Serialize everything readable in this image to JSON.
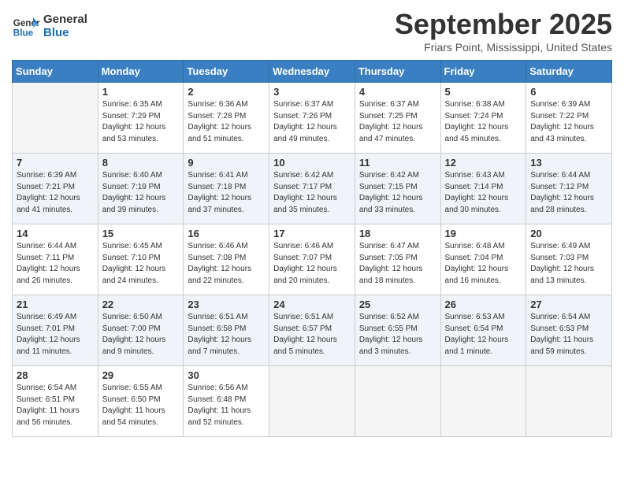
{
  "logo": {
    "line1": "General",
    "line2": "Blue"
  },
  "title": "September 2025",
  "location": "Friars Point, Mississippi, United States",
  "weekdays": [
    "Sunday",
    "Monday",
    "Tuesday",
    "Wednesday",
    "Thursday",
    "Friday",
    "Saturday"
  ],
  "weeks": [
    [
      {
        "day": null,
        "info": []
      },
      {
        "day": "1",
        "info": [
          "Sunrise: 6:35 AM",
          "Sunset: 7:29 PM",
          "Daylight: 12 hours",
          "and 53 minutes."
        ]
      },
      {
        "day": "2",
        "info": [
          "Sunrise: 6:36 AM",
          "Sunset: 7:28 PM",
          "Daylight: 12 hours",
          "and 51 minutes."
        ]
      },
      {
        "day": "3",
        "info": [
          "Sunrise: 6:37 AM",
          "Sunset: 7:26 PM",
          "Daylight: 12 hours",
          "and 49 minutes."
        ]
      },
      {
        "day": "4",
        "info": [
          "Sunrise: 6:37 AM",
          "Sunset: 7:25 PM",
          "Daylight: 12 hours",
          "and 47 minutes."
        ]
      },
      {
        "day": "5",
        "info": [
          "Sunrise: 6:38 AM",
          "Sunset: 7:24 PM",
          "Daylight: 12 hours",
          "and 45 minutes."
        ]
      },
      {
        "day": "6",
        "info": [
          "Sunrise: 6:39 AM",
          "Sunset: 7:22 PM",
          "Daylight: 12 hours",
          "and 43 minutes."
        ]
      }
    ],
    [
      {
        "day": "7",
        "info": [
          "Sunrise: 6:39 AM",
          "Sunset: 7:21 PM",
          "Daylight: 12 hours",
          "and 41 minutes."
        ]
      },
      {
        "day": "8",
        "info": [
          "Sunrise: 6:40 AM",
          "Sunset: 7:19 PM",
          "Daylight: 12 hours",
          "and 39 minutes."
        ]
      },
      {
        "day": "9",
        "info": [
          "Sunrise: 6:41 AM",
          "Sunset: 7:18 PM",
          "Daylight: 12 hours",
          "and 37 minutes."
        ]
      },
      {
        "day": "10",
        "info": [
          "Sunrise: 6:42 AM",
          "Sunset: 7:17 PM",
          "Daylight: 12 hours",
          "and 35 minutes."
        ]
      },
      {
        "day": "11",
        "info": [
          "Sunrise: 6:42 AM",
          "Sunset: 7:15 PM",
          "Daylight: 12 hours",
          "and 33 minutes."
        ]
      },
      {
        "day": "12",
        "info": [
          "Sunrise: 6:43 AM",
          "Sunset: 7:14 PM",
          "Daylight: 12 hours",
          "and 30 minutes."
        ]
      },
      {
        "day": "13",
        "info": [
          "Sunrise: 6:44 AM",
          "Sunset: 7:12 PM",
          "Daylight: 12 hours",
          "and 28 minutes."
        ]
      }
    ],
    [
      {
        "day": "14",
        "info": [
          "Sunrise: 6:44 AM",
          "Sunset: 7:11 PM",
          "Daylight: 12 hours",
          "and 26 minutes."
        ]
      },
      {
        "day": "15",
        "info": [
          "Sunrise: 6:45 AM",
          "Sunset: 7:10 PM",
          "Daylight: 12 hours",
          "and 24 minutes."
        ]
      },
      {
        "day": "16",
        "info": [
          "Sunrise: 6:46 AM",
          "Sunset: 7:08 PM",
          "Daylight: 12 hours",
          "and 22 minutes."
        ]
      },
      {
        "day": "17",
        "info": [
          "Sunrise: 6:46 AM",
          "Sunset: 7:07 PM",
          "Daylight: 12 hours",
          "and 20 minutes."
        ]
      },
      {
        "day": "18",
        "info": [
          "Sunrise: 6:47 AM",
          "Sunset: 7:05 PM",
          "Daylight: 12 hours",
          "and 18 minutes."
        ]
      },
      {
        "day": "19",
        "info": [
          "Sunrise: 6:48 AM",
          "Sunset: 7:04 PM",
          "Daylight: 12 hours",
          "and 16 minutes."
        ]
      },
      {
        "day": "20",
        "info": [
          "Sunrise: 6:49 AM",
          "Sunset: 7:03 PM",
          "Daylight: 12 hours",
          "and 13 minutes."
        ]
      }
    ],
    [
      {
        "day": "21",
        "info": [
          "Sunrise: 6:49 AM",
          "Sunset: 7:01 PM",
          "Daylight: 12 hours",
          "and 11 minutes."
        ]
      },
      {
        "day": "22",
        "info": [
          "Sunrise: 6:50 AM",
          "Sunset: 7:00 PM",
          "Daylight: 12 hours",
          "and 9 minutes."
        ]
      },
      {
        "day": "23",
        "info": [
          "Sunrise: 6:51 AM",
          "Sunset: 6:58 PM",
          "Daylight: 12 hours",
          "and 7 minutes."
        ]
      },
      {
        "day": "24",
        "info": [
          "Sunrise: 6:51 AM",
          "Sunset: 6:57 PM",
          "Daylight: 12 hours",
          "and 5 minutes."
        ]
      },
      {
        "day": "25",
        "info": [
          "Sunrise: 6:52 AM",
          "Sunset: 6:55 PM",
          "Daylight: 12 hours",
          "and 3 minutes."
        ]
      },
      {
        "day": "26",
        "info": [
          "Sunrise: 6:53 AM",
          "Sunset: 6:54 PM",
          "Daylight: 12 hours",
          "and 1 minute."
        ]
      },
      {
        "day": "27",
        "info": [
          "Sunrise: 6:54 AM",
          "Sunset: 6:53 PM",
          "Daylight: 11 hours",
          "and 59 minutes."
        ]
      }
    ],
    [
      {
        "day": "28",
        "info": [
          "Sunrise: 6:54 AM",
          "Sunset: 6:51 PM",
          "Daylight: 11 hours",
          "and 56 minutes."
        ]
      },
      {
        "day": "29",
        "info": [
          "Sunrise: 6:55 AM",
          "Sunset: 6:50 PM",
          "Daylight: 11 hours",
          "and 54 minutes."
        ]
      },
      {
        "day": "30",
        "info": [
          "Sunrise: 6:56 AM",
          "Sunset: 6:48 PM",
          "Daylight: 11 hours",
          "and 52 minutes."
        ]
      },
      {
        "day": null,
        "info": []
      },
      {
        "day": null,
        "info": []
      },
      {
        "day": null,
        "info": []
      },
      {
        "day": null,
        "info": []
      }
    ]
  ]
}
